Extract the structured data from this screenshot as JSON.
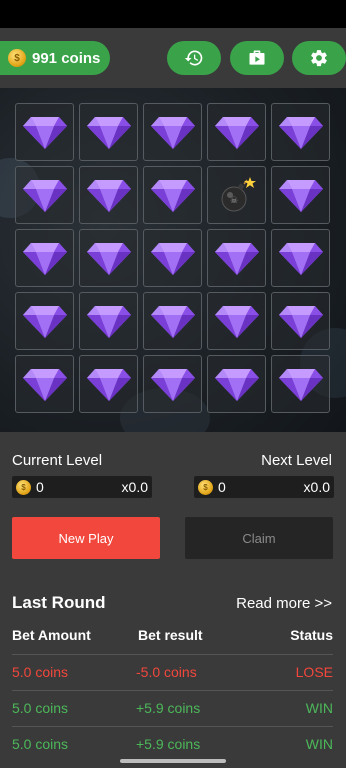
{
  "header": {
    "coins_label": "991 coins",
    "coin_symbol": "$",
    "buttons": [
      "history-icon",
      "wallet-icon",
      "settings-icon"
    ],
    "accent": "#3aa34a"
  },
  "board": {
    "rows": 5,
    "cols": 5,
    "cells": [
      "gem",
      "gem",
      "gem",
      "gem",
      "gem",
      "gem",
      "gem",
      "gem",
      "bomb",
      "gem",
      "gem",
      "gem",
      "gem",
      "gem",
      "gem",
      "gem",
      "gem",
      "gem",
      "gem",
      "gem",
      "gem",
      "gem",
      "gem",
      "gem",
      "gem"
    ],
    "gem_color": "#9b5cf0",
    "bomb_glyph": "☠"
  },
  "levels": {
    "current_label": "Current Level",
    "current_amount": "0",
    "current_multiplier": "x0.0",
    "next_label": "Next Level",
    "next_amount": "0",
    "next_multiplier": "x0.0"
  },
  "actions": {
    "new_play": "New Play",
    "claim": "Claim"
  },
  "last_round": {
    "title": "Last Round",
    "read_more": "Read more >>",
    "columns": [
      "Bet Amount",
      "Bet result",
      "Status"
    ],
    "rows": [
      {
        "amount": "5.0 coins",
        "result": "-5.0  coins",
        "status": "LOSE",
        "kind": "lose"
      },
      {
        "amount": "5.0 coins",
        "result": "+5.9  coins",
        "status": "WIN",
        "kind": "win"
      },
      {
        "amount": "5.0 coins",
        "result": "+5.9  coins",
        "status": "WIN",
        "kind": "win"
      }
    ]
  }
}
